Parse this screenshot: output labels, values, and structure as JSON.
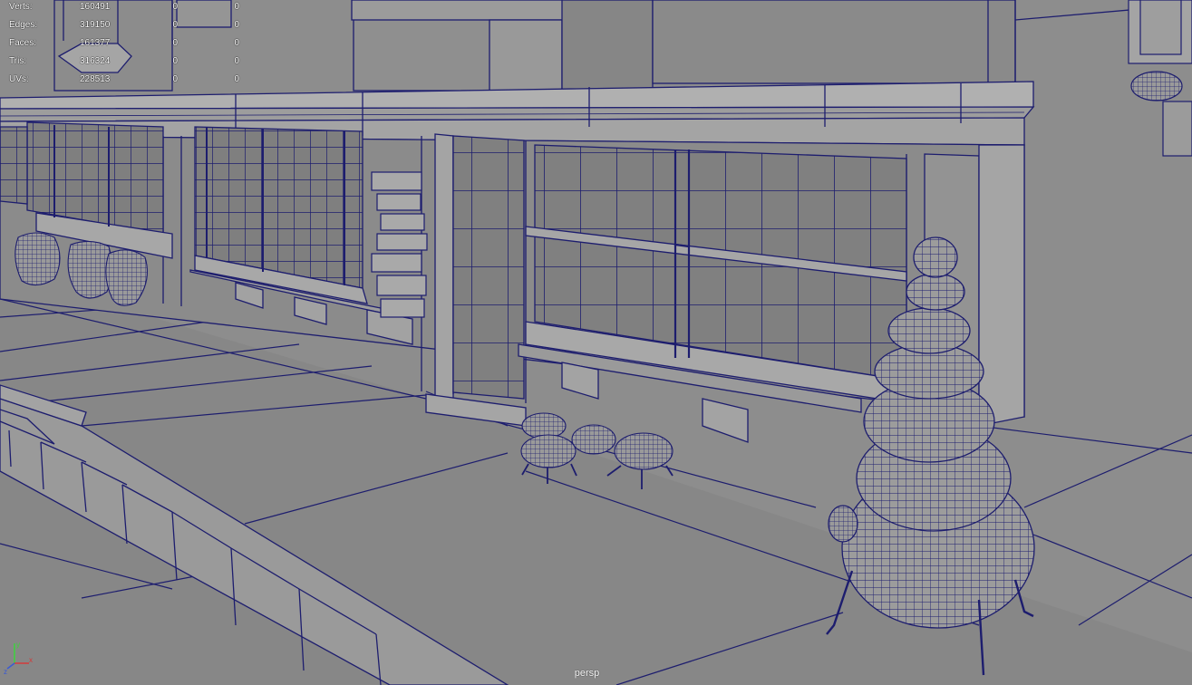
{
  "hud": {
    "rows": [
      {
        "label": "Verts:",
        "total": "160491",
        "selected": "0",
        "component": "0"
      },
      {
        "label": "Edges:",
        "total": "319150",
        "selected": "0",
        "component": "0"
      },
      {
        "label": "Faces:",
        "total": "161377",
        "selected": "0",
        "component": "0"
      },
      {
        "label": "Tris:",
        "total": "316324",
        "selected": "0",
        "component": "0"
      },
      {
        "label": "UVs:",
        "total": "228513",
        "selected": "0",
        "component": "0"
      }
    ]
  },
  "camera": {
    "name": "persp"
  },
  "axis_gizmo": {
    "x": "x",
    "y": "y",
    "z": "z"
  },
  "colors": {
    "background": "#8d8d8d",
    "wire": "#1d1d6e",
    "hud_text": "#ffffff",
    "axis_x": "#d43a3a",
    "axis_y": "#3ad43a",
    "axis_z": "#3a5ad4"
  }
}
